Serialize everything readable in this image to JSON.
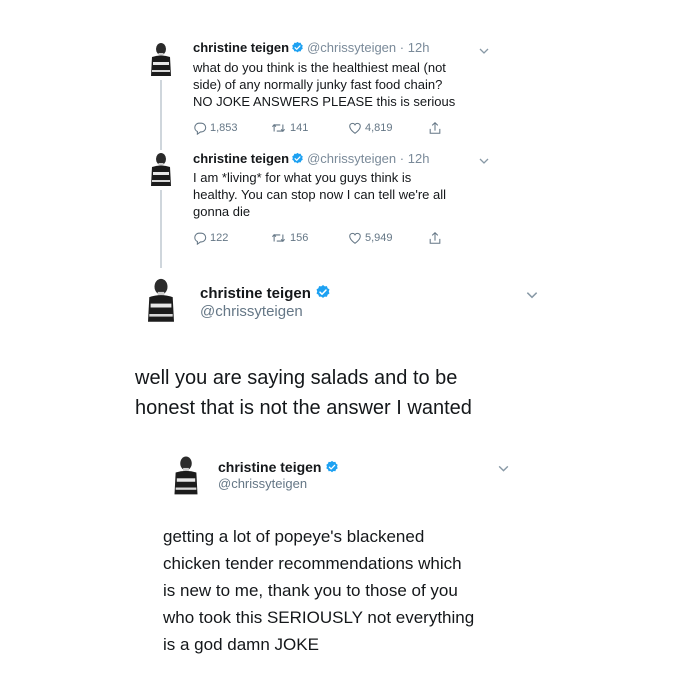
{
  "tweet1": {
    "name": "christine teigen",
    "handle": "@chrissyteigen",
    "separator": "·",
    "time": "12h",
    "text_lines": [
      "what do you think is the healthiest meal (not",
      "side) of any normally junky fast food chain?",
      "NO JOKE ANSWERS PLEASE this is serious"
    ],
    "replies": "1,853",
    "retweets": "141",
    "likes": "4,819"
  },
  "tweet2": {
    "name": "christine teigen",
    "handle": "@chrissyteigen",
    "separator": "·",
    "time": "12h",
    "text_lines": [
      "I am *living* for what you guys think is",
      "healthy. You can stop now I can tell we're all",
      "gonna die"
    ],
    "replies": "122",
    "retweets": "156",
    "likes": "5,949"
  },
  "tweet3": {
    "name": "christine teigen",
    "handle": "@chrissyteigen",
    "text_lines": [
      "well you are saying salads and to be",
      "honest that is not the answer I wanted"
    ]
  },
  "tweet4": {
    "name": "christine teigen",
    "handle": "@chrissyteigen",
    "text_lines": [
      "getting a lot of popeye's blackened",
      "chicken tender recommendations which",
      "is new to me, thank you to those of you",
      "who took this SERIOUSLY not everything",
      "is a god damn JOKE"
    ]
  },
  "icons": {
    "verified": "verified-badge-icon",
    "chevron": "chevron-down-icon",
    "reply": "reply-icon",
    "retweet": "retweet-icon",
    "like": "heart-icon",
    "share": "share-icon"
  },
  "colors": {
    "verified_blue": "#1da1f2",
    "handle_gray": "#7a8a99",
    "thread_line": "#cfd6dc"
  }
}
